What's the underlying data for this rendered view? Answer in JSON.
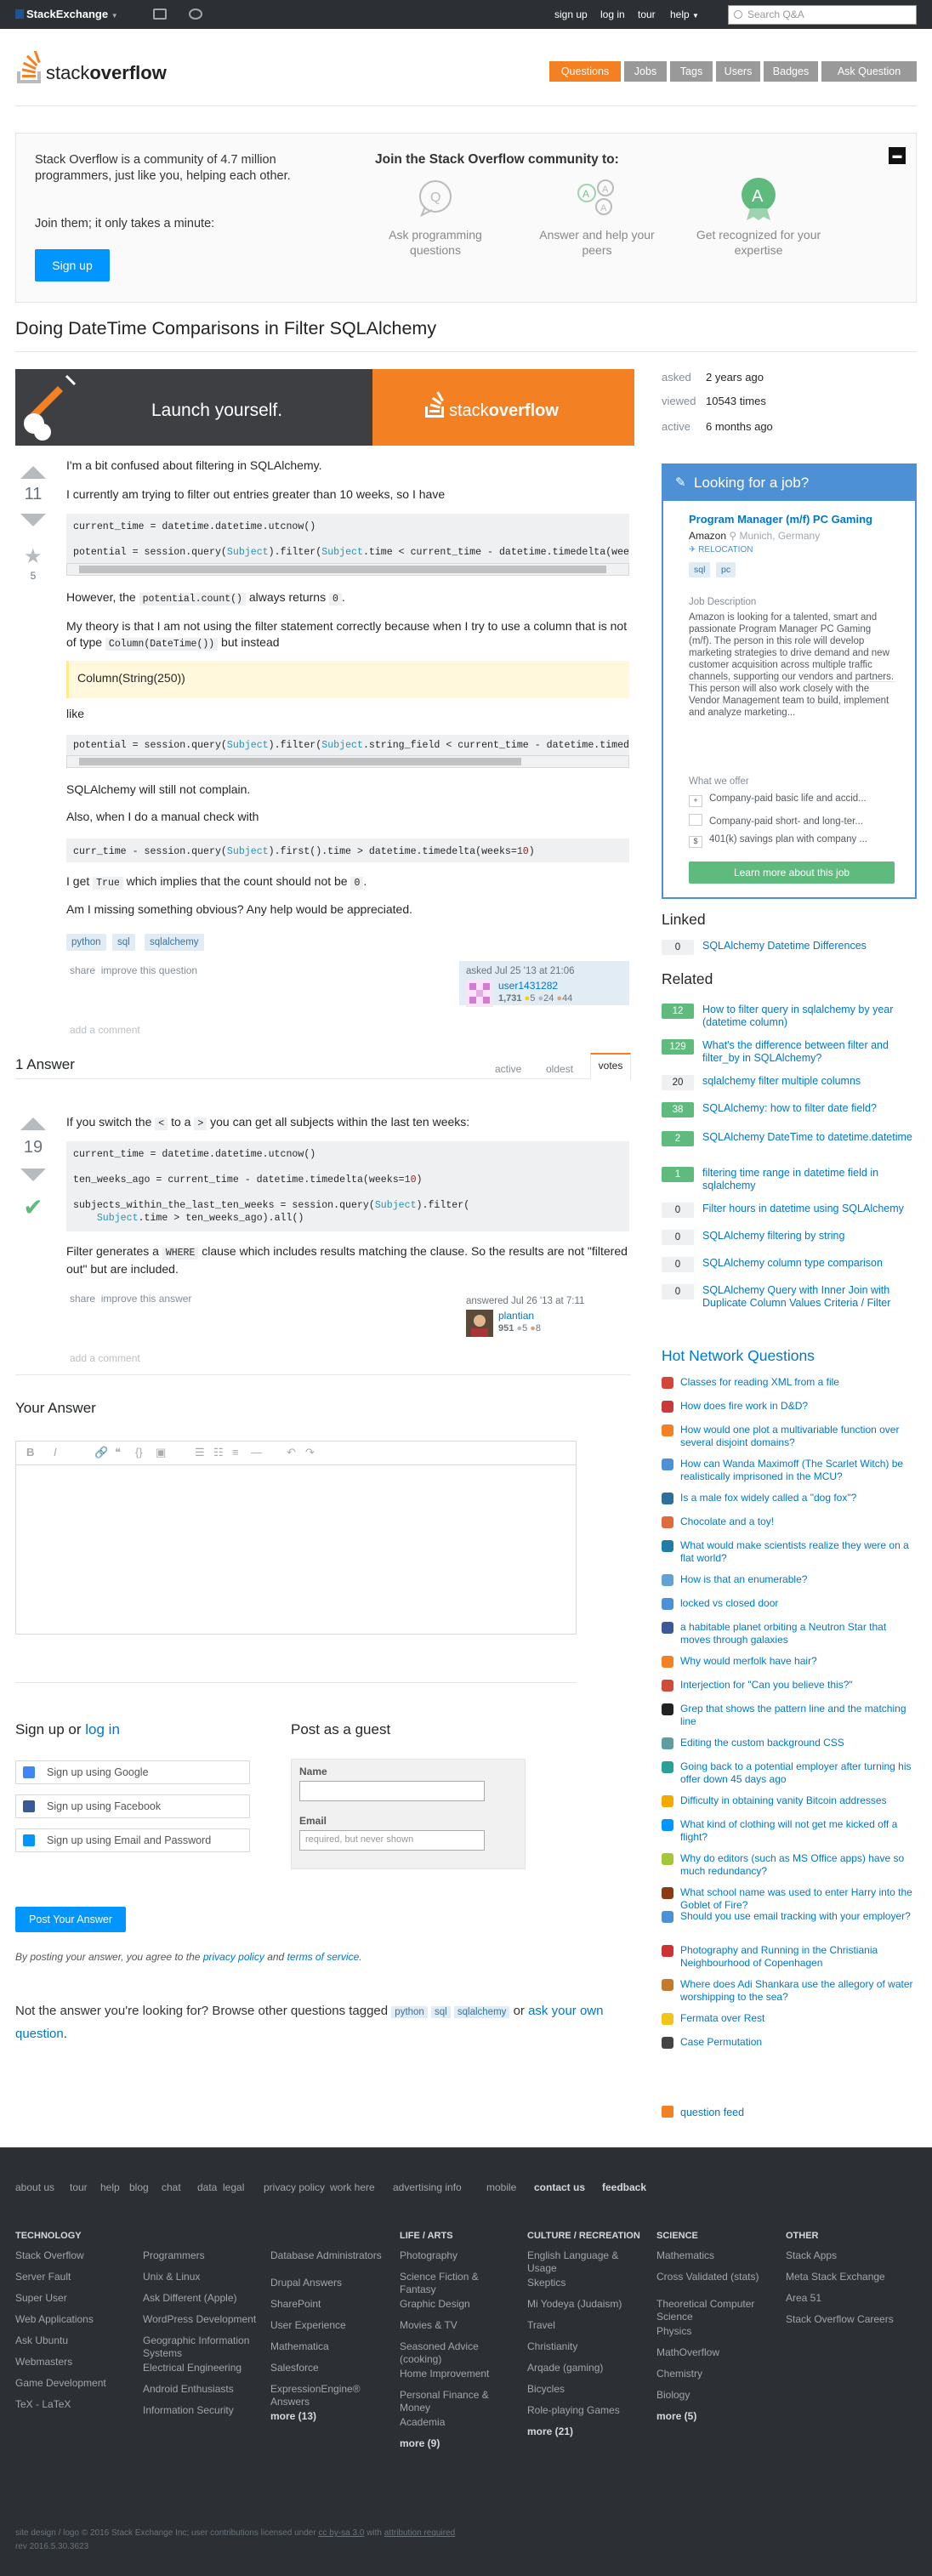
{
  "topbar": {
    "brand": "StackExchange",
    "links": [
      "sign up",
      "log in",
      "tour",
      "help"
    ],
    "search_placeholder": "Search Q&A"
  },
  "nav": [
    "Questions",
    "Jobs",
    "Tags",
    "Users",
    "Badges",
    "Ask Question"
  ],
  "community": {
    "intro": "Stack Overflow is a community of 4.7 million programmers, just like you, helping each other.",
    "join_line": "Join them; it only takes a minute:",
    "signup": "Sign up",
    "heading": "Join the Stack Overflow community to:",
    "features": [
      "Ask programming questions",
      "Answer and help your peers",
      "Get recognized for your expertise"
    ]
  },
  "question": {
    "title": "Doing DateTime Comparisons in Filter SQLAlchemy",
    "votes": "11",
    "favorites": "5",
    "p1": "I'm a bit confused about filtering in SQLAlchemy.",
    "p2": "I currently am trying to filter out entries greater than 10 weeks, so I have",
    "code1": "current_time = datetime.datetime.utcnow()\n\npotential = session.query(Subject).filter(Subject.time < current_time - datetime.timedelta(weeks=10))",
    "p3_a": "However, the",
    "p3_code": "potential.count()",
    "p3_b": "always returns",
    "p3_code2": "0",
    "p4_a": "My theory is that I am not using the filter statement correctly because when I try to use a column that is not of type",
    "p4_code": "Column(DateTime())",
    "p4_b": "but instead",
    "quote": "Column(String(250))",
    "p5": "like",
    "code2": "potential = session.query(Subject).filter(Subject.string_field < current_time - datetime.timedelta(weeks=10))",
    "p6": "SQLAlchemy will still not complain.",
    "p7": "Also, when I do a manual check with",
    "code3": "curr_time - session.query(Subject).first().time > datetime.timedelta(weeks=10)",
    "p8_a": "I get",
    "p8_code": "True",
    "p8_b": "which implies that the count should not be",
    "p8_code2": "0",
    "p9": "Am I missing something obvious? Any help would be appreciated.",
    "tags": [
      "python",
      "sql",
      "sqlalchemy"
    ],
    "menu": [
      "share",
      "improve this question"
    ],
    "asked": "asked Jul 25 '13 at 21:06",
    "user": "user1431282",
    "rep": "1,731",
    "badges": [
      "5",
      "24",
      "44"
    ],
    "add_comment": "add a comment"
  },
  "answers_header": {
    "count": "1 Answer",
    "tabs": [
      "active",
      "oldest",
      "votes"
    ]
  },
  "answer": {
    "votes": "19",
    "p1_a": "If you switch the",
    "p1_code1": "<",
    "p1_b": "to a",
    "p1_code2": ">",
    "p1_c": "you can get all subjects within the last ten weeks:",
    "code": "current_time = datetime.datetime.utcnow()\n\nten_weeks_ago = current_time - datetime.timedelta(weeks=10)\n\nsubjects_within_the_last_ten_weeks = session.query(Subject).filter(\n    Subject.time > ten_weeks_ago).all()",
    "p2_a": "Filter generates a",
    "p2_code": "WHERE",
    "p2_b": "clause which includes results matching the clause. So the results are not \"filtered out\" but are included.",
    "menu": [
      "share",
      "improve this answer"
    ],
    "answered": "answered Jul 26 '13 at 7:11",
    "user": "plantian",
    "rep": "951",
    "badges": [
      "5",
      "8"
    ],
    "add_comment": "add a comment"
  },
  "your_answer": {
    "heading": "Your Answer"
  },
  "signup": {
    "heading_a": "Sign up",
    "heading_or": "or",
    "heading_b": "log in",
    "google": "Sign up using Google",
    "facebook": "Sign up using Facebook",
    "email": "Sign up using Email and Password"
  },
  "guest": {
    "heading": "Post as a guest",
    "name_label": "Name",
    "email_label": "Email",
    "email_placeholder": "required, but never shown"
  },
  "post_button": "Post Your Answer",
  "terms": {
    "a": "By posting your answer, you agree to the",
    "privacy": "privacy policy",
    "and": "and",
    "tos": "terms of service",
    "end": "."
  },
  "not_answer": {
    "a": "Not the answer you're looking for? Browse other questions tagged",
    "tags": [
      "python",
      "sql",
      "sqlalchemy"
    ],
    "or": "or",
    "ask": "ask your own question",
    "end": "."
  },
  "sidebar": {
    "stats": [
      {
        "label": "asked",
        "value": "2 years ago"
      },
      {
        "label": "viewed",
        "value": "10543 times"
      },
      {
        "label": "active",
        "value": "6 months ago"
      }
    ],
    "job": {
      "heading": "Looking for a job?",
      "title": "Program Manager (m/f) PC Gaming",
      "company": "Amazon",
      "location": "Munich, Germany",
      "relocation": "RELOCATION",
      "tags": [
        "sql",
        "pc"
      ],
      "desc_label": "Job Description",
      "desc": "Amazon is looking for a talented, smart and passionate Program Manager PC Gaming (m/f). The person in this role will develop marketing strategies to drive demand and new customer acquisition across multiple traffic channels, supporting our vendors and partners. This person will also work closely with the Vendor Management team to build, implement and analyze marketing...",
      "offer_label": "What we offer",
      "offers": [
        "Company-paid basic life and accid...",
        "Company-paid short- and long-ter...",
        "401(k) savings plan with company ..."
      ],
      "button": "Learn more about this job"
    },
    "linked_heading": "Linked",
    "linked": [
      {
        "score": "0",
        "title": "SQLAlchemy Datetime Differences"
      }
    ],
    "related_heading": "Related",
    "related": [
      {
        "score": "12",
        "title": "How to filter query in sqlalchemy by year (datetime column)"
      },
      {
        "score": "129",
        "title": "What's the difference between filter and filter_by in SQLAlchemy?"
      },
      {
        "score": "20",
        "title": "sqlalchemy filter multiple columns"
      },
      {
        "score": "38",
        "title": "SQLAlchemy: how to filter date field?"
      },
      {
        "score": "2",
        "title": "SQLAlchemy DateTime to datetime.datetime"
      },
      {
        "score": "1",
        "title": "filtering time range in datetime field in sqlalchemy"
      },
      {
        "score": "0",
        "title": "Filter hours in datetime using SQLAlchemy"
      },
      {
        "score": "0",
        "title": "SQLAlchemy filtering by string"
      },
      {
        "score": "0",
        "title": "SQLAlchemy column type comparison"
      },
      {
        "score": "0",
        "title": "SQLAlchemy Query with Inner Join with Duplicate Column Values Criteria / Filter"
      }
    ],
    "hnq_heading": "Hot Network Questions",
    "hnq": [
      "Classes for reading XML from a file",
      "How does fire work in D&D?",
      "How would one plot a multivariable function over several disjoint domains?",
      "How can Wanda Maximoff (The Scarlet Witch) be realistically imprisoned in the MCU?",
      "Is a male fox widely called a \"dog fox\"?",
      "Chocolate and a toy!",
      "What would make scientists realize they were on a flat world?",
      "How is that an enumerable?",
      "locked vs closed door",
      "a habitable planet orbiting a Neutron Star that moves through galaxies",
      "Why would merfolk have hair?",
      "Interjection for \"Can you believe this?\"",
      "Grep that shows the pattern line and the matching line",
      "Editing the custom background CSS",
      "Going back to a potential employer after turning his offer down 45 days ago",
      "Difficulty in obtaining vanity Bitcoin addresses",
      "What kind of clothing will not get me kicked off a flight?",
      "Why do editors (such as MS Office apps) have so much redundancy?",
      "What school name was used to enter Harry into the Goblet of Fire?",
      "Should you use email tracking with your employer?",
      "Photography and Running in the Christiania Neighbourhood of Copenhagen",
      "Where does Adi Shankara use the allegory of water worshipping to the sea?",
      "Fermata over Rest",
      "Case Permutation"
    ],
    "hnq_colors": [
      "#d44638",
      "#c73b3b",
      "#f48024",
      "#4d90d5",
      "#2f6f9e",
      "#e06a3b",
      "#1e7ea8",
      "#61a3d6",
      "#4d90d5",
      "#3b5998",
      "#f48024",
      "#d04b3b",
      "#222222",
      "#5f9ea0",
      "#2aa198",
      "#f2a900",
      "#0095ff",
      "#a4c639",
      "#8a3b12",
      "#4d90d5",
      "#cc3333",
      "#c47a2c",
      "#f0c419",
      "#444444"
    ],
    "feed": "question feed"
  },
  "footer": {
    "links": [
      "about us",
      "tour",
      "help",
      "blog",
      "chat",
      "data",
      "legal",
      "privacy policy",
      "work here",
      "advertising info",
      "mobile",
      "contact us",
      "feedback"
    ],
    "cols": [
      {
        "heading": "Technology",
        "items": [
          "Stack Overflow",
          "Server Fault",
          "Super User",
          "Web Applications",
          "Ask Ubuntu",
          "Webmasters",
          "Game Development",
          "TeX - LaTeX"
        ]
      },
      {
        "heading": "",
        "items": [
          "Programmers",
          "Unix & Linux",
          "Ask Different (Apple)",
          "WordPress Development",
          "Geographic Information Systems",
          "Electrical Engineering",
          "Android Enthusiasts",
          "Information Security"
        ]
      },
      {
        "heading": "",
        "items": [
          "Database Administrators",
          "Drupal Answers",
          "SharePoint",
          "User Experience",
          "Mathematica",
          "Salesforce",
          "ExpressionEngine® Answers",
          "more (13)"
        ]
      },
      {
        "heading": "Life / Arts",
        "items": [
          "Photography",
          "Science Fiction & Fantasy",
          "Graphic Design",
          "Movies & TV",
          "Seasoned Advice (cooking)",
          "Home Improvement",
          "Personal Finance & Money",
          "Academia",
          "more (9)"
        ]
      },
      {
        "heading": "Culture / Recreation",
        "items": [
          "English Language & Usage",
          "Skeptics",
          "Mi Yodeya (Judaism)",
          "Travel",
          "Christianity",
          "Arqade (gaming)",
          "Bicycles",
          "Role-playing Games",
          "more (21)"
        ]
      },
      {
        "heading": "Science",
        "items": [
          "Mathematics",
          "Cross Validated (stats)",
          "Theoretical Computer Science",
          "Physics",
          "MathOverflow",
          "Chemistry",
          "Biology",
          "more (5)"
        ]
      },
      {
        "heading": "Other",
        "items": [
          "Stack Apps",
          "Meta Stack Exchange",
          "Area 51",
          "Stack Overflow Careers"
        ]
      }
    ],
    "bottom_a": "site design / logo © 2016 Stack Exchange Inc; user contributions licensed under",
    "bottom_license": "cc by-sa 3.0",
    "bottom_b": "with",
    "bottom_attr": "attribution required",
    "rev": "rev 2016.5.30.3623"
  }
}
